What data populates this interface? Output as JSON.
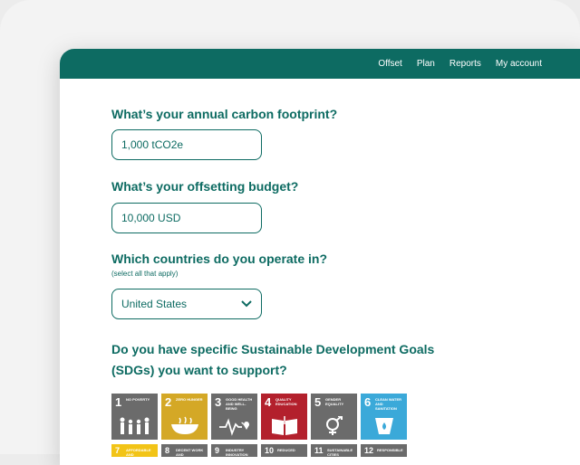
{
  "nav": {
    "items": [
      "Offset",
      "Plan",
      "Reports",
      "My account"
    ]
  },
  "colors": {
    "brand": "#0d6b62"
  },
  "form": {
    "q1": "What’s your annual carbon footprint?",
    "q1_value": "1,000 tCO2e",
    "q2": "What’s your offsetting budget?",
    "q2_value": "10,000 USD",
    "q3": "Which countries do you operate in?",
    "q3_hint": "(select all that apply)",
    "q3_value": "United States",
    "q4_line1": "Do you have specific Sustainable Development Goals",
    "q4_line2": "(SDGs) you want to support?"
  },
  "sdgs": [
    {
      "num": "1",
      "label": "No poverty",
      "color": "#6b6b6b",
      "icon": "family-icon"
    },
    {
      "num": "2",
      "label": "Zero hunger",
      "color": "#d4a826",
      "icon": "bowl-icon"
    },
    {
      "num": "3",
      "label": "Good health and well-being",
      "color": "#6b6b6b",
      "icon": "heartbeat-icon"
    },
    {
      "num": "4",
      "label": "Quality education",
      "color": "#b3202c",
      "icon": "book-icon"
    },
    {
      "num": "5",
      "label": "Gender equality",
      "color": "#6b6b6b",
      "icon": "gender-icon"
    },
    {
      "num": "6",
      "label": "Clean water and sanitation",
      "color": "#3ba9d9",
      "icon": "water-icon"
    }
  ],
  "sdgs_row2": [
    {
      "num": "7",
      "label": "Affordable and",
      "color": "#f2c417"
    },
    {
      "num": "8",
      "label": "Decent work and",
      "color": "#6b6b6b"
    },
    {
      "num": "9",
      "label": "Industry innovation",
      "color": "#6b6b6b"
    },
    {
      "num": "10",
      "label": "Reduced",
      "color": "#6b6b6b"
    },
    {
      "num": "11",
      "label": "Sustainable cities",
      "color": "#6b6b6b"
    },
    {
      "num": "12",
      "label": "Responsible",
      "color": "#6b6b6b"
    }
  ]
}
